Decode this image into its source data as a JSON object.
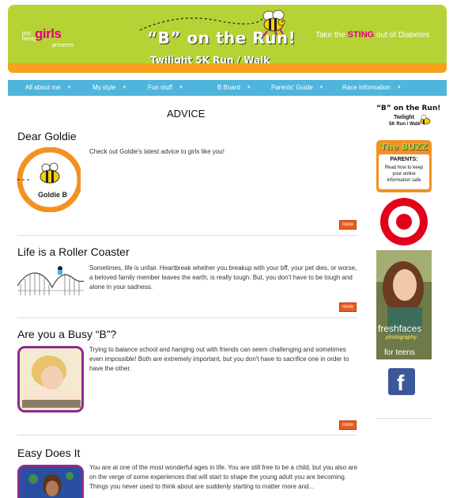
{
  "header": {
    "logo": {
      "just": "just",
      "being": "being",
      "girls": "girls",
      "presents": "presents"
    },
    "title": "“B” on the Run!",
    "subtitle": "Twilight 5K Run / Walk",
    "tagline_pre": "Take the ",
    "tagline_sting": "STING",
    "tagline_post": " out of Diabetes"
  },
  "nav": {
    "items": [
      {
        "label": "All about me"
      },
      {
        "label": "My style"
      },
      {
        "label": "Fun stuff"
      },
      {
        "label": "B Board"
      },
      {
        "label": "Parents' Guide"
      },
      {
        "label": "Race Information"
      }
    ]
  },
  "page": {
    "title": "ADVICE"
  },
  "articles": [
    {
      "title": "Dear Goldie",
      "text": "Check out Goldie's latest advice to girls like you!",
      "more": "more",
      "thumb_text": "Goldie B"
    },
    {
      "title": "Life is a Roller Coaster",
      "text": "Sometimes, life is unfair. Heartbreak whether you breakup with your bff, your pet dies, or worse, a beloved family member leaves the earth, is really tough. But, you don't have to be tough and alone in your sadness.",
      "more": "more"
    },
    {
      "title": "Are you a Busy “B”?",
      "text": "Trying to balance school and hanging out with friends can seem challenging and sometimes even impossible! Both are extremely important, but you don't have to sacrifice one in order to have the other.",
      "more": "more"
    },
    {
      "title": "Easy Does It",
      "text": "You are at one of the most wonderful ages in life. You are still free to be a child, but you also are on the verge of some experiences that will start to shape the young adult you are becoming. Things you never used to think about are suddenly starting to matter more and..."
    }
  ],
  "sidebar": {
    "run_title": "“B” on the Run!",
    "run_sub_1": "Twilight",
    "run_sub_2": "5K Run / Walk",
    "buzz_title": "The BUZZ",
    "buzz_parents": "PARENTS:",
    "buzz_text": "Read how to keep your online information safe",
    "fresh_title": "freshfaces",
    "fresh_photo": "photography",
    "fresh_teens": "for teens",
    "facebook": "f"
  },
  "colors": {
    "banner_green": "#b5d334",
    "banner_orange": "#f6a21e",
    "nav_blue": "#4fb5dc",
    "more_orange": "#e85d1f",
    "girls_pink": "#e5007e",
    "target_red": "#e2001a",
    "facebook_blue": "#3b5998"
  }
}
